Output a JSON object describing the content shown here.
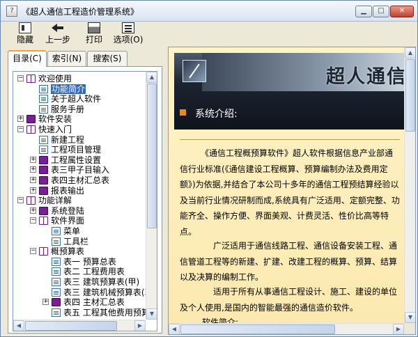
{
  "window": {
    "title": "《超人通信工程造价管理系统》",
    "min_glyph": "▁",
    "max_glyph": "□",
    "close_glyph": "✕"
  },
  "toolbar": {
    "hide_label": "隐藏",
    "back_label": "上一步",
    "print_label": "打印",
    "options_label": "选项(O)"
  },
  "tabs": {
    "contents": "目录(C)",
    "index": "索引(N)",
    "search": "搜索(S)"
  },
  "tree": {
    "nodes": [
      {
        "label": "欢迎使用",
        "level": 0,
        "expander": "⊟",
        "icon": "book-open"
      },
      {
        "label": "功能简介",
        "level": 1,
        "expander": "",
        "icon": "page",
        "selected": true
      },
      {
        "label": "关于超人软件",
        "level": 1,
        "expander": "",
        "icon": "page"
      },
      {
        "label": "服务手册",
        "level": 1,
        "expander": "",
        "icon": "page"
      },
      {
        "label": "软件安装",
        "level": 0,
        "expander": "⊞",
        "icon": "book-closed"
      },
      {
        "label": "快速入门",
        "level": 0,
        "expander": "⊟",
        "icon": "book-open"
      },
      {
        "label": "新建工程",
        "level": 1,
        "expander": "",
        "icon": "page"
      },
      {
        "label": "工程项目管理",
        "level": 1,
        "expander": "",
        "icon": "page"
      },
      {
        "label": "工程属性设置",
        "level": 1,
        "expander": "⊞",
        "icon": "book-closed"
      },
      {
        "label": "表三甲子目输入",
        "level": 1,
        "expander": "⊞",
        "icon": "book-closed"
      },
      {
        "label": "表四主材汇总表",
        "level": 1,
        "expander": "⊞",
        "icon": "book-closed"
      },
      {
        "label": "报表输出",
        "level": 1,
        "expander": "⊞",
        "icon": "book-closed"
      },
      {
        "label": "功能详解",
        "level": 0,
        "expander": "⊟",
        "icon": "book-open"
      },
      {
        "label": "系统登陆",
        "level": 1,
        "expander": "⊞",
        "icon": "book-closed"
      },
      {
        "label": "软件界面",
        "level": 1,
        "expander": "⊟",
        "icon": "book-open"
      },
      {
        "label": "菜单",
        "level": 2,
        "expander": "",
        "icon": "page"
      },
      {
        "label": "工具栏",
        "level": 2,
        "expander": "",
        "icon": "page"
      },
      {
        "label": "概预算表",
        "level": 1,
        "expander": "⊟",
        "icon": "book-open"
      },
      {
        "label": "表一 预算总表",
        "level": 2,
        "expander": "",
        "icon": "page"
      },
      {
        "label": "表二 工程费用表",
        "level": 2,
        "expander": "",
        "icon": "page"
      },
      {
        "label": "表三 建筑预算表(甲)",
        "level": 2,
        "expander": "",
        "icon": "page"
      },
      {
        "label": "表三 建筑机械预算表(乙",
        "level": 2,
        "expander": "",
        "icon": "page"
      },
      {
        "label": "表四 主材汇总表",
        "level": 2,
        "expander": "⊞",
        "icon": "book-closed"
      },
      {
        "label": "表五 工程其他费用预算(",
        "level": 2,
        "expander": "",
        "icon": "page"
      }
    ]
  },
  "content": {
    "banner_title": "超人通信",
    "section_label": "系统介绍:",
    "paragraphs": [
      "《通信工程概预算软件》超人软件根据信息产业部通信行业标准(《通信建设工程概算、预算编制办法及费用定额》)为依据,并结合了本公司十多年的通信工程预结算经验以及当前行业情况研制而成,系统具有广泛适用、定额完整、功能齐全、操作方便、界面美观、计费灵活、性价比高等特点。",
      "广泛适用于通信线路工程、通信设备安装工程、通信管道工程等的新建、扩建、改建工程的概算、预算、结算以及决算的编制工作。",
      "适用于所有从事通信工程设计、施工、建设的单位及个人使用,是国内的智能最强的通信造价软件。",
      "软件简介:"
    ]
  },
  "scrollbar": {
    "up": "▲",
    "down": "▼",
    "left": "◀",
    "right": "▶"
  },
  "colors": {
    "selection": "#316ac5",
    "book": "#7a1f93",
    "content_bg": "#fff3c7",
    "accent_bullet": "#e48b1e"
  }
}
